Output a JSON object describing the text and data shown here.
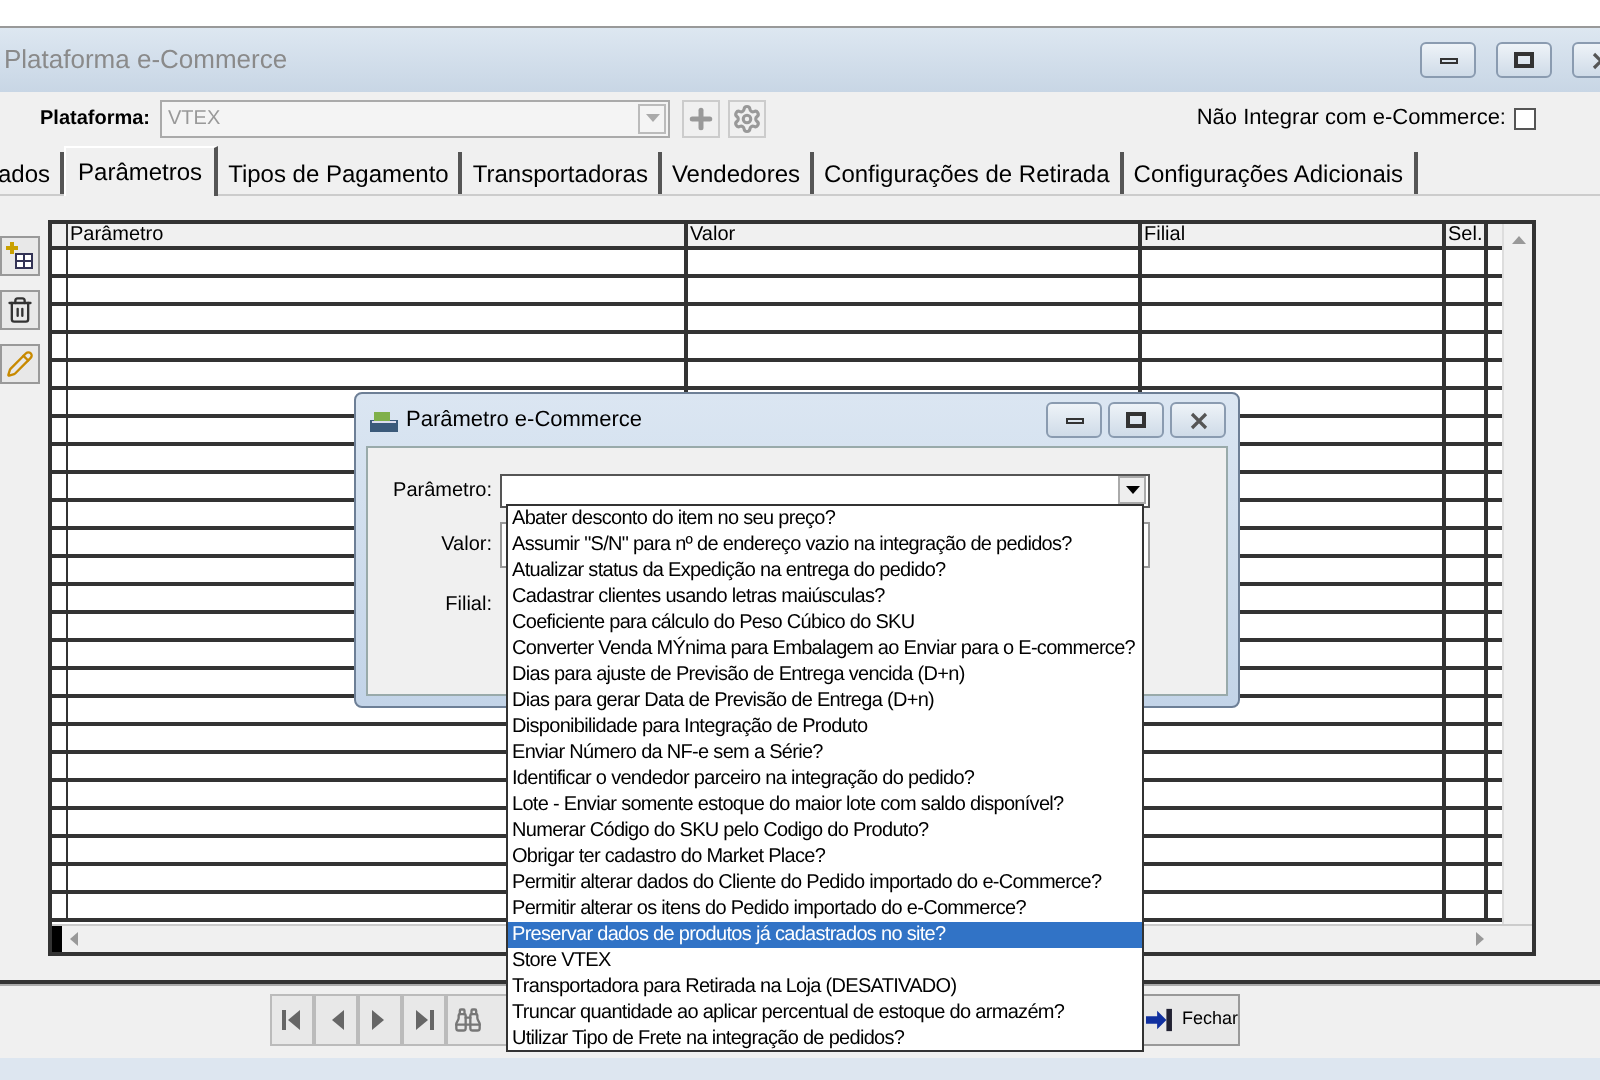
{
  "window": {
    "title": "Plataforma e-Commerce"
  },
  "toolbar": {
    "platform_label": "Plataforma:",
    "platform_value": "VTEX",
    "no_integrate_label": "Não Integrar com e-Commerce:",
    "no_integrate_checked": false
  },
  "tabs": [
    {
      "label": "ados",
      "selected": false
    },
    {
      "label": "Parâmetros",
      "selected": true
    },
    {
      "label": "Tipos de Pagamento",
      "selected": false
    },
    {
      "label": "Transportadoras",
      "selected": false
    },
    {
      "label": "Vendedores",
      "selected": false
    },
    {
      "label": "Configurações de Retirada",
      "selected": false
    },
    {
      "label": "Configurações Adicionais",
      "selected": false
    }
  ],
  "grid": {
    "columns": [
      "Parâmetro",
      "Valor",
      "Filial",
      "Sel."
    ]
  },
  "footer": {
    "close_button": "Fechar"
  },
  "dialog": {
    "title": "Parâmetro e-Commerce",
    "fields": [
      {
        "label": "Parâmetro:"
      },
      {
        "label": "Valor:"
      },
      {
        "label": "Filial:"
      }
    ]
  },
  "dropdown": {
    "options": [
      {
        "label": "Abater desconto do item no seu preço?",
        "selected": false
      },
      {
        "label": "Assumir \"S/N\" para nº de endereço vazio na integração de pedidos?",
        "selected": false
      },
      {
        "label": "Atualizar status da Expedição na entrega do pedido?",
        "selected": false
      },
      {
        "label": "Cadastrar clientes usando letras maiúsculas?",
        "selected": false
      },
      {
        "label": "Coeficiente para cálculo do Peso Cúbico do SKU",
        "selected": false
      },
      {
        "label": "Converter Venda MÝnima para Embalagem ao Enviar para o E-commerce?",
        "selected": false
      },
      {
        "label": "Dias para ajuste de Previsão de Entrega vencida (D+n)",
        "selected": false
      },
      {
        "label": "Dias para gerar Data de Previsão de Entrega (D+n)",
        "selected": false
      },
      {
        "label": "Disponibilidade para Integração de Produto",
        "selected": false
      },
      {
        "label": "Enviar Número da NF-e sem a Série?",
        "selected": false
      },
      {
        "label": "Identificar o vendedor parceiro na integração do pedido?",
        "selected": false
      },
      {
        "label": "Lote - Enviar somente estoque do maior lote com saldo disponível?",
        "selected": false
      },
      {
        "label": "Numerar Código do SKU pelo Codigo do Produto?",
        "selected": false
      },
      {
        "label": "Obrigar ter cadastro do Market Place?",
        "selected": false
      },
      {
        "label": "Permitir alterar dados do Cliente do Pedido importado do e-Commerce?",
        "selected": false
      },
      {
        "label": "Permitir alterar os itens do Pedido importado do e-Commerce?",
        "selected": false
      },
      {
        "label": "Preservar dados de produtos já cadastrados no site?",
        "selected": true
      },
      {
        "label": "Store VTEX",
        "selected": false
      },
      {
        "label": "Transportadora para Retirada na Loja (DESATIVADO)",
        "selected": false
      },
      {
        "label": "Truncar quantidade ao aplicar percentual de estoque do armazém?",
        "selected": false
      },
      {
        "label": "Utilizar Tipo de Frete na integração de pedidos?",
        "selected": false
      }
    ]
  }
}
